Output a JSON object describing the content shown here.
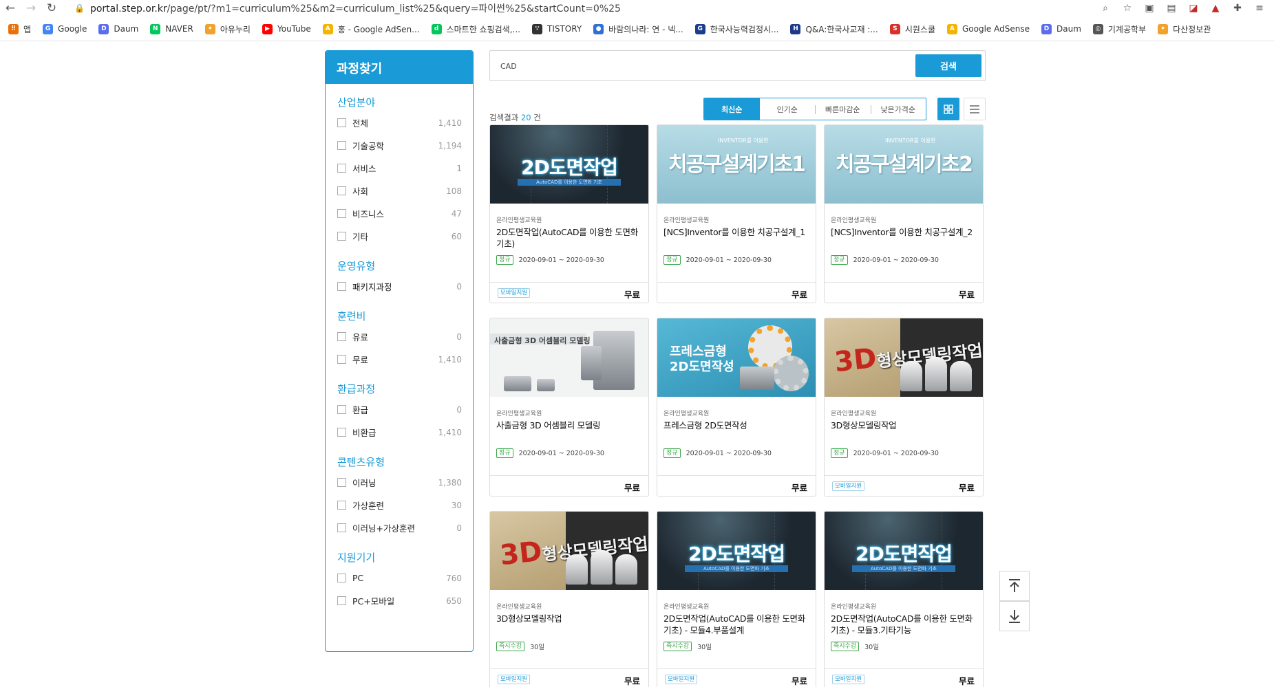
{
  "browser": {
    "url_host": "portal.step.or.kr",
    "url_path": "/page/pt/?m1=curriculum%25&m2=curriculum_list%25&query=파이썬%25&startCount=0%25",
    "bookmarks": [
      {
        "label": "앱",
        "color": "#e8710a",
        "glyph": "⠿"
      },
      {
        "label": "Google",
        "color": "#4285f4",
        "glyph": "G"
      },
      {
        "label": "Daum",
        "color": "#5b6cf0",
        "glyph": "D"
      },
      {
        "label": "NAVER",
        "color": "#03c75a",
        "glyph": "N"
      },
      {
        "label": "아유누리",
        "color": "#f2a12b",
        "glyph": "✦"
      },
      {
        "label": "YouTube",
        "color": "#ff0000",
        "glyph": "▶"
      },
      {
        "label": "홍 - Google AdSen...",
        "color": "#f4b400",
        "glyph": "A"
      },
      {
        "label": "스마트한 쇼핑검색,...",
        "color": "#03c75a",
        "glyph": "d"
      },
      {
        "label": "TISTORY",
        "color": "#333333",
        "glyph": "∵"
      },
      {
        "label": "바람의나라: 연 - 넥...",
        "color": "#2e6fd9",
        "glyph": "●"
      },
      {
        "label": "한국사능력검정시...",
        "color": "#1a3d8f",
        "glyph": "G"
      },
      {
        "label": "Q&A:한국사교재 :...",
        "color": "#1d3a8a",
        "glyph": "H"
      },
      {
        "label": "시원스쿨",
        "color": "#d9302c",
        "glyph": "S"
      },
      {
        "label": "Google AdSense",
        "color": "#f4b400",
        "glyph": "A"
      },
      {
        "label": "Daum",
        "color": "#5b6cf0",
        "glyph": "D"
      },
      {
        "label": "기계공학부",
        "color": "#555555",
        "glyph": "◎"
      },
      {
        "label": "다산정보관",
        "color": "#f2a12b",
        "glyph": "✦"
      }
    ]
  },
  "sidebar": {
    "title": "과정찾기",
    "groups": [
      {
        "title": "산업분야",
        "items": [
          {
            "label": "전체",
            "count": "1,410"
          },
          {
            "label": "기술공학",
            "count": "1,194"
          },
          {
            "label": "서비스",
            "count": "1"
          },
          {
            "label": "사회",
            "count": "108"
          },
          {
            "label": "비즈니스",
            "count": "47"
          },
          {
            "label": "기타",
            "count": "60"
          }
        ]
      },
      {
        "title": "운영유형",
        "items": [
          {
            "label": "패키지과정",
            "count": "0"
          }
        ]
      },
      {
        "title": "훈련비",
        "items": [
          {
            "label": "유료",
            "count": "0"
          },
          {
            "label": "무료",
            "count": "1,410"
          }
        ]
      },
      {
        "title": "환급과정",
        "items": [
          {
            "label": "환급",
            "count": "0"
          },
          {
            "label": "비환급",
            "count": "1,410"
          }
        ]
      },
      {
        "title": "콘텐츠유형",
        "items": [
          {
            "label": "이러닝",
            "count": "1,380"
          },
          {
            "label": "가상훈련",
            "count": "30"
          },
          {
            "label": "이러닝+가상훈련",
            "count": "0"
          }
        ]
      },
      {
        "title": "지원기기",
        "items": [
          {
            "label": "PC",
            "count": "760"
          },
          {
            "label": "PC+모바일",
            "count": "650"
          }
        ]
      }
    ]
  },
  "search": {
    "value": "CAD",
    "button_label": "검색"
  },
  "results": {
    "prefix": "검색결과",
    "count": "20",
    "suffix": "건"
  },
  "sort_tabs": [
    "최신순",
    "인기순",
    "빠른마감순",
    "낮은가격순"
  ],
  "cards": [
    {
      "thumb_text": "2D도면작업",
      "thumb_sub": "AutoCAD를 이용한 도면화 기초",
      "thumb_style": "dark",
      "provider": "온라인평생교육원",
      "title": "2D도면작업(AutoCAD를 이용한 도면화 기초)",
      "tag": "정규",
      "period": "2020-09-01 ~ 2020-09-30",
      "mobile": "모바일지원",
      "price": "무료"
    },
    {
      "thumb_text": "치공구설계기초1",
      "thumb_sub": "INVENTOR를 이용한",
      "thumb_style": "light",
      "provider": "온라인평생교육원",
      "title": "[NCS]Inventor를 이용한 치공구설계_1",
      "tag": "정규",
      "period": "2020-09-01 ~ 2020-09-30",
      "mobile": "",
      "price": "무료"
    },
    {
      "thumb_text": "치공구설계기초2",
      "thumb_sub": "INVENTOR를 이용한",
      "thumb_style": "light",
      "provider": "온라인평생교육원",
      "title": "[NCS]Inventor를 이용한 치공구설계_2",
      "tag": "정규",
      "period": "2020-09-01 ~ 2020-09-30",
      "mobile": "",
      "price": "무료"
    },
    {
      "thumb_text": "사출금형 3D 어셈블리 모델링",
      "thumb_sub": "",
      "thumb_style": "white",
      "provider": "온라인평생교육원",
      "title": "사출금형 3D 어셈블리 모델링",
      "tag": "정규",
      "period": "2020-09-01 ~ 2020-09-30",
      "mobile": "",
      "price": "무료"
    },
    {
      "thumb_text": "프레스금형 2D도면작성",
      "thumb_sub": "",
      "thumb_style": "teal",
      "provider": "온라인평생교육원",
      "title": "프레스금형 2D도면작성",
      "tag": "정규",
      "period": "2020-09-01 ~ 2020-09-30",
      "mobile": "",
      "price": "무료"
    },
    {
      "thumb_text": "형상모델링작업",
      "thumb_sub": "3D",
      "thumb_style": "tan",
      "provider": "온라인평생교육원",
      "title": "3D형상모델링작업",
      "tag": "정규",
      "period": "2020-09-01 ~ 2020-09-30",
      "mobile": "모바일지원",
      "price": "무료"
    },
    {
      "thumb_text": "형상모델링작업",
      "thumb_sub": "3D",
      "thumb_style": "tan",
      "provider": "온라인평생교육원",
      "title": "3D형상모델링작업",
      "tag": "즉시수강",
      "period": "30일",
      "mobile": "모바일지원",
      "price": "무료"
    },
    {
      "thumb_text": "2D도면작업",
      "thumb_sub": "AutoCAD를 이용한 도면화 기초",
      "thumb_style": "dark",
      "provider": "온라인평생교육원",
      "title": "2D도면작업(AutoCAD를 이용한 도면화 기초) - 모듈4.부품설계",
      "tag": "즉시수강",
      "period": "30일",
      "mobile": "모바일지원",
      "price": "무료"
    },
    {
      "thumb_text": "2D도면작업",
      "thumb_sub": "AutoCAD를 이용한 도면화 기초",
      "thumb_style": "dark",
      "provider": "온라인평생교육원",
      "title": "2D도면작업(AutoCAD를 이용한 도면화 기초) - 모듈3.기타기능",
      "tag": "즉시수강",
      "period": "30일",
      "mobile": "모바일지원",
      "price": "무료"
    }
  ],
  "colors": {
    "accent": "#1a9ad6",
    "tag_green": "#3aa648"
  }
}
